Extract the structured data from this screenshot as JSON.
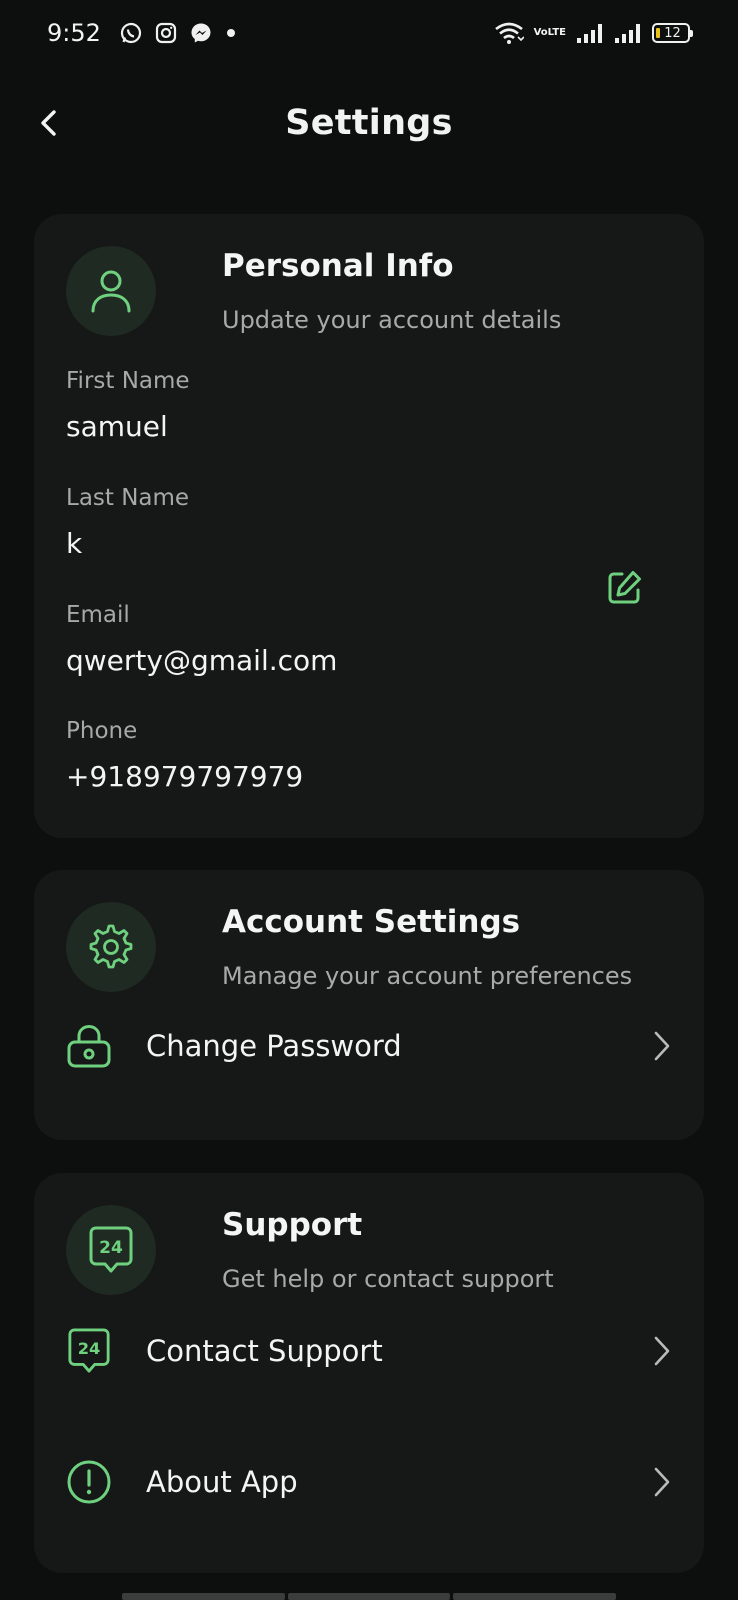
{
  "status_bar": {
    "time": "9:52",
    "notification_icons": [
      "whatsapp-icon",
      "instagram-icon",
      "messenger-icon",
      "dot-icon"
    ],
    "volte_top": "Vo",
    "volte_bottom": "LTE",
    "battery": "12"
  },
  "header": {
    "title": "Settings"
  },
  "personal_info": {
    "title": "Personal Info",
    "subtitle": "Update your account details",
    "fields": [
      {
        "label": "First Name",
        "value": "samuel"
      },
      {
        "label": "Last Name",
        "value": "k"
      },
      {
        "label": "Email",
        "value": "qwerty@gmail.com"
      },
      {
        "label": "Phone",
        "value": "+918979797979"
      }
    ]
  },
  "account_settings": {
    "title": "Account Settings",
    "subtitle": "Manage your account preferences",
    "items": [
      {
        "label": "Change Password",
        "icon": "lock-icon"
      }
    ]
  },
  "support": {
    "title": "Support",
    "subtitle": "Get help or contact support",
    "badge": "24",
    "items": [
      {
        "label": "Contact Support",
        "icon": "support-24-icon",
        "badge": "24"
      },
      {
        "label": "About App",
        "icon": "info-icon"
      }
    ]
  },
  "colors": {
    "background": "#0d0f0e",
    "card": "#151816",
    "accent": "#6fd17f",
    "icon_circle": "#1f2a22"
  }
}
